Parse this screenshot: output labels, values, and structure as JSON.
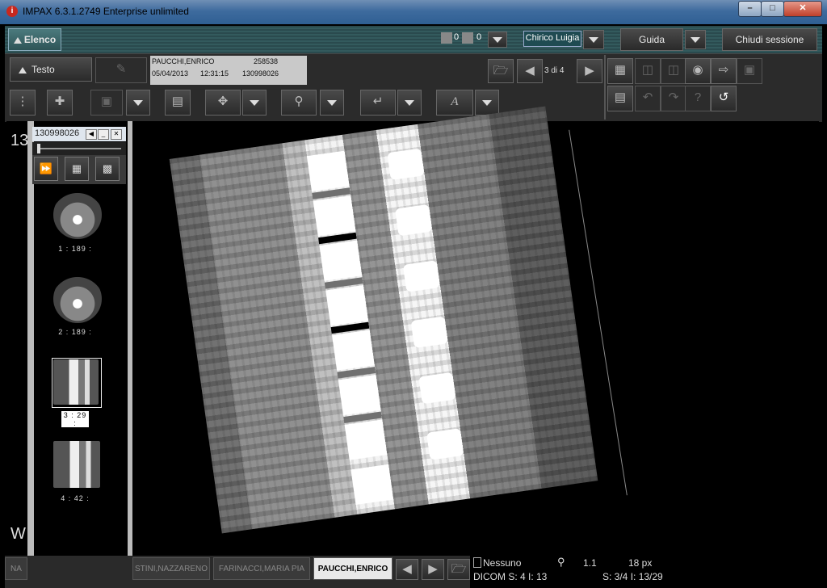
{
  "window": {
    "title": "IMPAX 6.3.1.2749 Enterprise unlimited",
    "app_icon": "i"
  },
  "toolbar_top": {
    "elenco_label": "Elenco",
    "alert_count_1": "0",
    "alert_count_2": "0",
    "user_name": "Chirico Luigia",
    "guida_label": "Guida",
    "chiudi_label": "Chiudi sessione"
  },
  "toolbar_second": {
    "testo_label": "Testo",
    "patient_name": "PAUCCHI,ENRICO",
    "patient_id": "258538",
    "study_date": "05/04/2013",
    "study_time": "12:31:15",
    "accession": "130998026",
    "page_indicator": "3 di 4"
  },
  "viewport": {
    "overlay_top_left": "13",
    "overlay_bottom_left": "W"
  },
  "study_panel": {
    "title": "130998026",
    "series": [
      {
        "label": "1 : 189 :"
      },
      {
        "label": "2 : 189 :"
      },
      {
        "label": "3 : 29 :"
      },
      {
        "label": "4 : 42 :"
      }
    ],
    "selected_series": 3
  },
  "patient_tabs": [
    "NA",
    "STINI,NAZZARENO",
    "FARINACCI,MARIA PIA",
    "PAUCCHI,ENRICO"
  ],
  "status": {
    "layout_label": "Nessuno",
    "zoom": "1.1",
    "pixel_size": "18 px",
    "dicom_line": "DICOM S: 4  I: 13",
    "series_line": "S: 3/4  I: 13/29"
  },
  "colors": {
    "accent_teal": "#335a5d",
    "title_bar": "#3e6b9e",
    "close_red": "#c0402a"
  }
}
